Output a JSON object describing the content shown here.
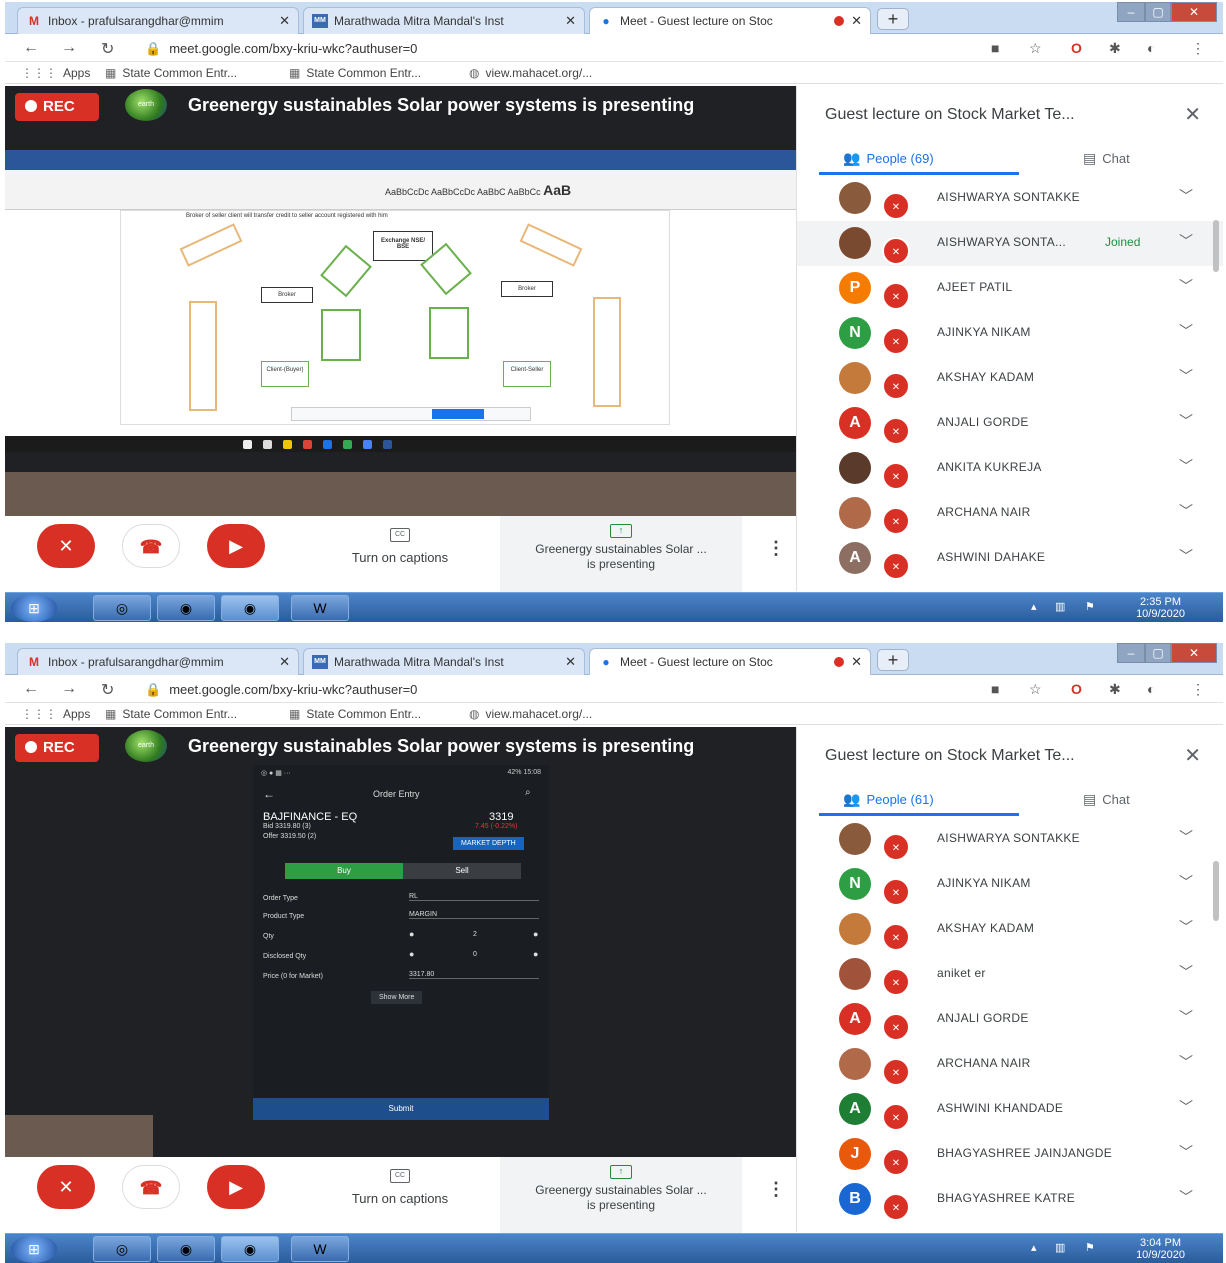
{
  "screens": [
    {
      "tabs": [
        {
          "label": "Inbox - prafulsarangdhar@mmim",
          "icon": "M"
        },
        {
          "label": "Marathwada Mitra Mandal's Inst",
          "icon": "MM"
        },
        {
          "label": "Meet - Guest lecture on Stoc",
          "icon": "meet"
        }
      ],
      "url": "meet.google.com/bxy-kriu-wkc?authuser=0",
      "bookmarks": [
        "Apps",
        "State Common Entr...",
        "State Common Entr...",
        "view.mahacet.org/..."
      ],
      "rec_label": "REC",
      "presenting_banner": "Greenergy sustainables Solar power systems is presenting",
      "diagram": {
        "exchange": "Exchange NSE/ BSE",
        "broker_left": "Broker",
        "broker_right": "Broker",
        "client_buyer": "Client-(Buyer)",
        "client_seller": "Client-Seller",
        "doc_line": "Broker of seller client will transfer credit to seller account registered with him"
      },
      "controls": {
        "captions": "Turn on captions",
        "presenting_line1": "Greenergy sustainables Solar ...",
        "presenting_line2": "is presenting"
      },
      "panel": {
        "title": "Guest lecture on Stock Market Te...",
        "people_tab": "People (69)",
        "chat_tab": "Chat",
        "participants": [
          {
            "initial": "",
            "name": "AISHWARYA SONTAKKE",
            "color": "#8a5a3c",
            "status": ""
          },
          {
            "initial": "",
            "name": "AISHWARYA SONTA...",
            "color": "#7a4a30",
            "status": "Joined"
          },
          {
            "initial": "P",
            "name": "AJEET PATIL",
            "color": "#f57c00",
            "status": ""
          },
          {
            "initial": "N",
            "name": "AJINKYA NIKAM",
            "color": "#2e9e44",
            "status": ""
          },
          {
            "initial": "",
            "name": "AKSHAY KADAM",
            "color": "#c47a3a",
            "status": ""
          },
          {
            "initial": "A",
            "name": "ANJALI GORDE",
            "color": "#d93025",
            "status": ""
          },
          {
            "initial": "",
            "name": "ANKITA KUKREJA",
            "color": "#5a3a2a",
            "status": ""
          },
          {
            "initial": "",
            "name": "ARCHANA NAIR",
            "color": "#b06a4a",
            "status": ""
          },
          {
            "initial": "A",
            "name": "ASHWINI DAHAKE",
            "color": "#8d6e63",
            "status": ""
          }
        ]
      },
      "clock": {
        "time": "2:35 PM",
        "date": "10/9/2020"
      }
    },
    {
      "tabs": [
        {
          "label": "Inbox - prafulsarangdhar@mmim",
          "icon": "M"
        },
        {
          "label": "Marathwada Mitra Mandal's Inst",
          "icon": "MM"
        },
        {
          "label": "Meet - Guest lecture on Stoc",
          "icon": "meet"
        }
      ],
      "url": "meet.google.com/bxy-kriu-wkc?authuser=0",
      "bookmarks": [
        "Apps",
        "State Common Entr...",
        "State Common Entr...",
        "view.mahacet.org/..."
      ],
      "rec_label": "REC",
      "presenting_banner": "Greenergy sustainables Solar power systems is presenting",
      "phone": {
        "status": "42% 15:08",
        "header": "Order Entry",
        "symbol": "BAJFINANCE - EQ",
        "price": "3319",
        "change": "7.45 (-0.22%)",
        "bid": "Bid    3319.80 (3)",
        "offer": "Offer  3319.50 (2)",
        "market_depth": "MARKET DEPTH",
        "buy": "Buy",
        "sell": "Sell",
        "order_type_label": "Order Type",
        "order_type_value": "RL",
        "product_type_label": "Product Type",
        "product_type_value": "MARGIN",
        "qty_label": "Qty",
        "qty_value": "2",
        "disclosed_label": "Disclosed Qty",
        "disclosed_value": "0",
        "price_label": "Price (0 for Market)",
        "price_value": "3317.80",
        "show_more": "Show More",
        "submit": "Submit"
      },
      "controls": {
        "captions": "Turn on captions",
        "presenting_line1": "Greenergy sustainables Solar ...",
        "presenting_line2": "is presenting"
      },
      "panel": {
        "title": "Guest lecture on Stock Market Te...",
        "people_tab": "People (61)",
        "chat_tab": "Chat",
        "participants": [
          {
            "initial": "",
            "name": "AISHWARYA SONTAKKE",
            "color": "#8a5a3c",
            "status": ""
          },
          {
            "initial": "N",
            "name": "AJINKYA NIKAM",
            "color": "#2e9e44",
            "status": ""
          },
          {
            "initial": "",
            "name": "AKSHAY KADAM",
            "color": "#c47a3a",
            "status": ""
          },
          {
            "initial": "",
            "name": "aniket er",
            "color": "#a0523a",
            "status": ""
          },
          {
            "initial": "A",
            "name": "ANJALI GORDE",
            "color": "#d93025",
            "status": ""
          },
          {
            "initial": "",
            "name": "ARCHANA NAIR",
            "color": "#b06a4a",
            "status": ""
          },
          {
            "initial": "A",
            "name": "ASHWINI KHANDADE",
            "color": "#1e7e34",
            "status": ""
          },
          {
            "initial": "J",
            "name": "BHAGYASHREE JAINJANGDE",
            "color": "#e8590c",
            "status": ""
          },
          {
            "initial": "B",
            "name": "BHAGYASHREE KATRE",
            "color": "#1967d2",
            "status": ""
          }
        ]
      },
      "clock": {
        "time": "3:04 PM",
        "date": "10/9/2020"
      }
    }
  ]
}
